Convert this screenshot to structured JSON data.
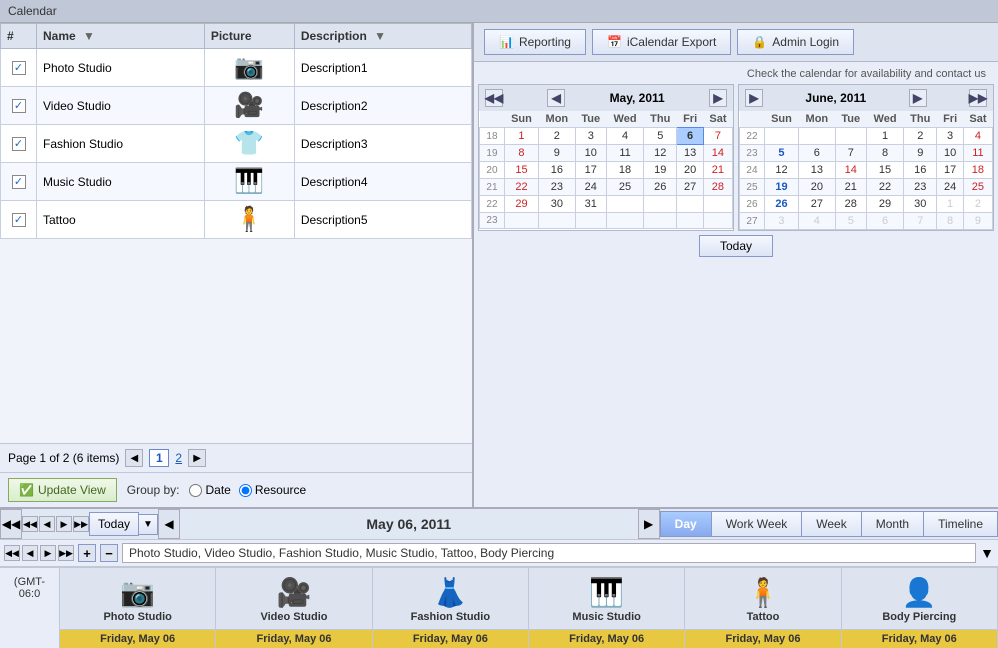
{
  "app": {
    "title": "Calendar"
  },
  "top_buttons": {
    "reporting": "Reporting",
    "icalendar": "iCalendar Export",
    "admin": "Admin Login"
  },
  "table": {
    "columns": [
      "#",
      "Name",
      "Picture",
      "Description"
    ],
    "rows": [
      {
        "checked": true,
        "name": "Photo Studio",
        "icon": "📷",
        "description": "Description1"
      },
      {
        "checked": true,
        "name": "Video Studio",
        "icon": "🎥",
        "description": "Description2"
      },
      {
        "checked": true,
        "name": "Fashion Studio",
        "icon": "👕",
        "description": "Description3"
      },
      {
        "checked": true,
        "name": "Music Studio",
        "icon": "🎹",
        "description": "Description4"
      },
      {
        "checked": true,
        "name": "Tattoo",
        "icon": "🧍",
        "description": "Description5"
      }
    ]
  },
  "pagination": {
    "label": "Page 1 of 2 (6 items)",
    "current_page": 1,
    "pages": [
      1,
      2
    ]
  },
  "bottom_controls": {
    "update_btn": "Update View",
    "group_by": "Group by:",
    "date_option": "Date",
    "resource_option": "Resource",
    "selected_group": "Resource"
  },
  "availability_text": "Check the calendar for availability and contact us",
  "may_calendar": {
    "title": "May, 2011",
    "days": [
      "Sun",
      "Mon",
      "Tue",
      "Wed",
      "Thu",
      "Fri",
      "Sat"
    ],
    "weeks": [
      {
        "week_num": 18,
        "days": [
          1,
          2,
          3,
          4,
          5,
          6,
          7
        ],
        "types": [
          "red_x",
          "",
          "",
          "",
          "",
          "today",
          "red"
        ]
      },
      {
        "week_num": 19,
        "days": [
          8,
          9,
          10,
          11,
          12,
          13,
          14
        ],
        "types": [
          "red_x",
          "",
          "",
          "",
          "",
          "",
          "red"
        ]
      },
      {
        "week_num": 20,
        "days": [
          15,
          16,
          17,
          18,
          19,
          20,
          21
        ],
        "types": [
          "red_x",
          "",
          "",
          "",
          "",
          "",
          "red"
        ]
      },
      {
        "week_num": 21,
        "days": [
          22,
          23,
          24,
          25,
          26,
          27,
          28
        ],
        "types": [
          "red_x",
          "",
          "",
          "",
          "",
          "",
          "red"
        ]
      },
      {
        "week_num": 22,
        "days": [
          29,
          30,
          31,
          "",
          "",
          "",
          ""
        ],
        "types": [
          "red_x",
          "",
          "",
          "",
          "",
          "",
          ""
        ]
      },
      {
        "week_num": 23,
        "days": [
          "",
          "",
          "",
          "",
          "",
          "",
          ""
        ],
        "types": [
          "",
          "",
          "",
          "",
          "",
          "",
          ""
        ]
      }
    ]
  },
  "june_calendar": {
    "title": "June, 2011",
    "days": [
      "Sun",
      "Mon",
      "Tue",
      "Wed",
      "Thu",
      "Fri",
      "Sat"
    ],
    "weeks": [
      {
        "week_num": 22,
        "days": [
          "",
          "",
          "",
          1,
          2,
          3,
          4
        ],
        "types": [
          "",
          "",
          "",
          "",
          "",
          "",
          "red"
        ]
      },
      {
        "week_num": 23,
        "days": [
          5,
          6,
          7,
          8,
          9,
          10,
          11
        ],
        "types": [
          "blue",
          "",
          "",
          "",
          "",
          "",
          "red"
        ]
      },
      {
        "week_num": 24,
        "days": [
          12,
          13,
          14,
          15,
          16,
          17,
          18
        ],
        "types": [
          "",
          "",
          "red",
          "",
          "",
          "",
          "red"
        ]
      },
      {
        "week_num": 25,
        "days": [
          19,
          20,
          21,
          22,
          23,
          24,
          25
        ],
        "types": [
          "blue",
          "",
          "",
          "",
          "",
          "",
          "red"
        ]
      },
      {
        "week_num": 26,
        "days": [
          26,
          27,
          28,
          29,
          30,
          1,
          2
        ],
        "types": [
          "blue",
          "",
          "",
          "",
          "",
          "other",
          "other"
        ]
      },
      {
        "week_num": 27,
        "days": [
          3,
          4,
          5,
          6,
          7,
          8,
          9
        ],
        "types": [
          "other",
          "other",
          "other",
          "other",
          "other",
          "other",
          "other"
        ]
      }
    ]
  },
  "bottom_nav": {
    "today": "Today",
    "date_display": "May 06, 2011",
    "views": [
      "Day",
      "Work Week",
      "Week",
      "Month",
      "Timeline"
    ],
    "active_view": "Day"
  },
  "resource_bar_text": "Photo Studio, Video Studio, Fashion Studio, Music Studio, Tattoo, Body Piercing",
  "timezone": "(GMT-06:0",
  "resources": [
    {
      "name": "Photo Studio",
      "icon": "📷",
      "date": "Friday, May 06"
    },
    {
      "name": "Video Studio",
      "icon": "🎥",
      "date": "Friday, May 06"
    },
    {
      "name": "Fashion Studio",
      "icon": "👗",
      "date": "Friday, May 06"
    },
    {
      "name": "Music Studio",
      "icon": "🎹",
      "date": "Friday, May 06"
    },
    {
      "name": "Tattoo",
      "icon": "🧍",
      "date": "Friday, May 06"
    },
    {
      "name": "Body Piercing",
      "icon": "👤",
      "date": "Friday, May 06"
    }
  ]
}
